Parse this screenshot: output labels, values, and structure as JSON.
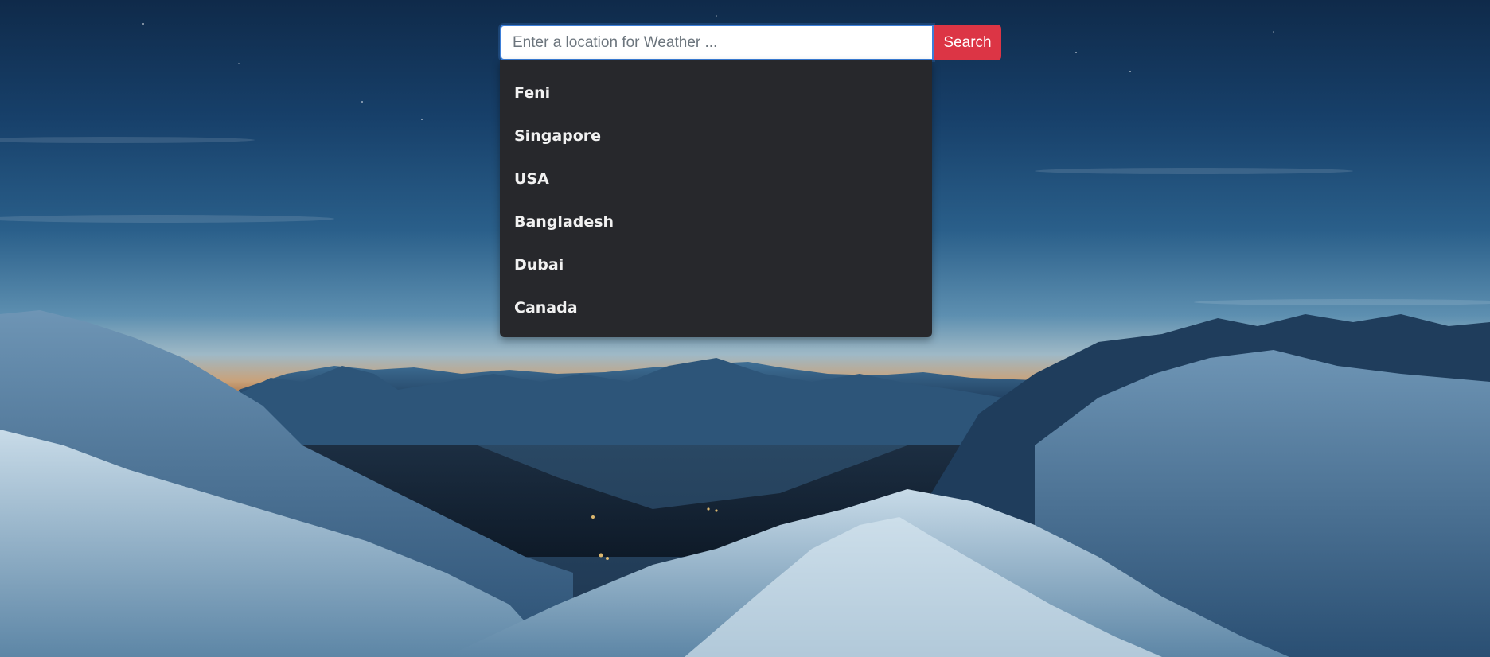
{
  "search": {
    "placeholder": "Enter a location for Weather ...",
    "value": "",
    "button_label": "Search"
  },
  "suggestions": [
    {
      "label": "Feni"
    },
    {
      "label": "Singapore"
    },
    {
      "label": "USA"
    },
    {
      "label": "Bangladesh"
    },
    {
      "label": "Dubai"
    },
    {
      "label": "Canada"
    }
  ],
  "background": {
    "description_icon": "mountain-landscape-background"
  },
  "colors": {
    "accent": "#dc3545",
    "focus": "#3d7fd9",
    "dropdown_bg": "#27282c",
    "dropdown_text": "#f1f1f1"
  }
}
